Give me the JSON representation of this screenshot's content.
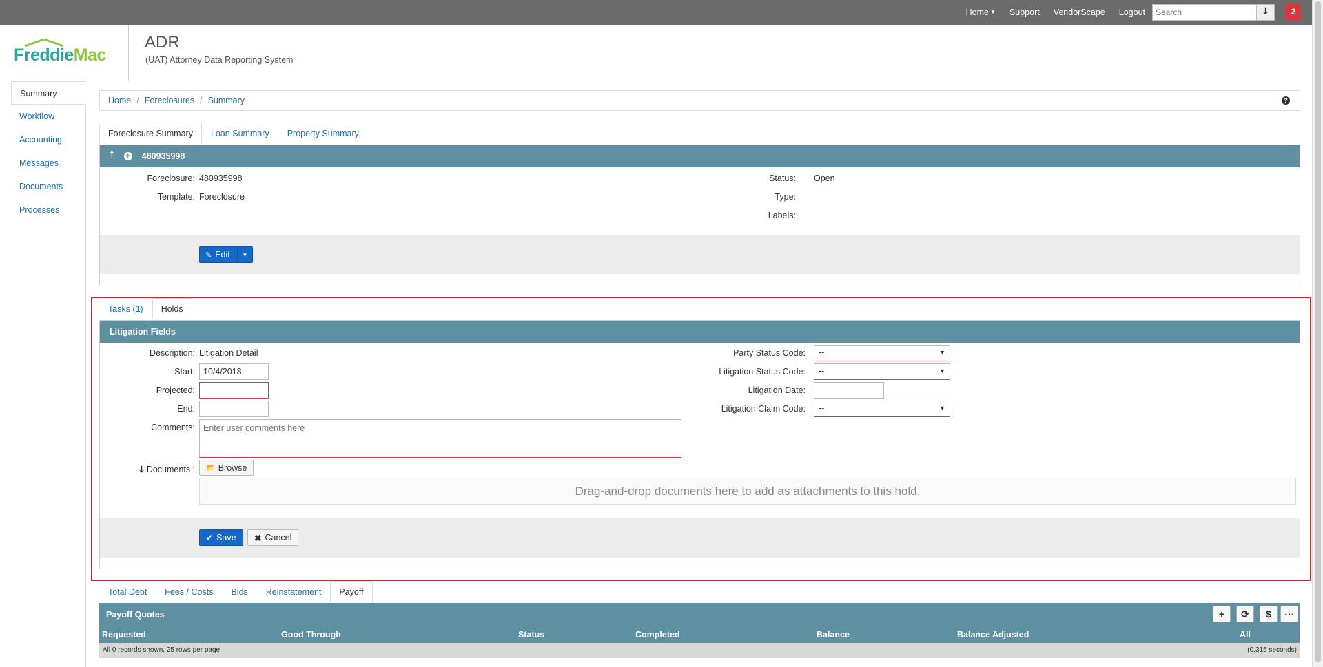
{
  "topnav": {
    "home": "Home",
    "support": "Support",
    "vendorscape": "VendorScape",
    "logout": "Logout",
    "search_placeholder": "Search",
    "notification_count": "2"
  },
  "header": {
    "logo_part1": "Freddie",
    "logo_part2": "Mac",
    "title": "ADR",
    "subtitle": "(UAT) Attorney Data Reporting System"
  },
  "sidebar": {
    "items": [
      {
        "label": "Summary"
      },
      {
        "label": "Workflow"
      },
      {
        "label": "Accounting"
      },
      {
        "label": "Messages"
      },
      {
        "label": "Documents"
      },
      {
        "label": "Processes"
      }
    ]
  },
  "breadcrumb": [
    "Home",
    "Foreclosures",
    "Summary"
  ],
  "summary_tabs": [
    "Foreclosure Summary",
    "Loan Summary",
    "Property Summary"
  ],
  "foreclosure": {
    "number": "480935998",
    "fields": {
      "foreclosure_label": "Foreclosure:",
      "foreclosure_value": "480935998",
      "template_label": "Template:",
      "template_value": "Foreclosure",
      "status_label": "Status:",
      "status_value": "Open",
      "type_label": "Type:",
      "labels_label": "Labels:"
    },
    "edit_label": "Edit"
  },
  "task_tabs": [
    "Tasks (1)",
    "Holds"
  ],
  "litigation": {
    "title": "Litigation Fields",
    "description_label": "Description:",
    "description_value": "Litigation Detail",
    "start_label": "Start:",
    "start_value": "10/4/2018",
    "projected_label": "Projected:",
    "end_label": "End:",
    "comments_label": "Comments:",
    "comments_placeholder": "Enter user comments here",
    "documents_label": "Documents :",
    "browse_label": "Browse",
    "dropzone_text": "Drag-and-drop documents here to add as attachments to this hold.",
    "party_status_label": "Party Status Code:",
    "party_status_value": "--",
    "litigation_status_label": "Litigation Status Code:",
    "litigation_status_value": "--",
    "litigation_date_label": "Litigation Date:",
    "litigation_claim_label": "Litigation Claim Code:",
    "litigation_claim_value": "--",
    "save_label": "Save",
    "cancel_label": "Cancel"
  },
  "bottom_tabs": [
    "Total Debt",
    "Fees / Costs",
    "Bids",
    "Reinstatement",
    "Payoff"
  ],
  "payoff": {
    "title": "Payoff Quotes",
    "columns": [
      "Requested",
      "Good Through",
      "Status",
      "Completed",
      "Balance",
      "Balance Adjusted",
      "All"
    ],
    "footer_left": "All 0 records shown. 25 rows per page",
    "footer_right": "(0.315 seconds)"
  },
  "colors": {
    "panel_header": "#5f90a2",
    "primary": "#1668c8",
    "link": "#1f6fb2",
    "highlight": "#c8282e",
    "required": "#d9363e"
  }
}
